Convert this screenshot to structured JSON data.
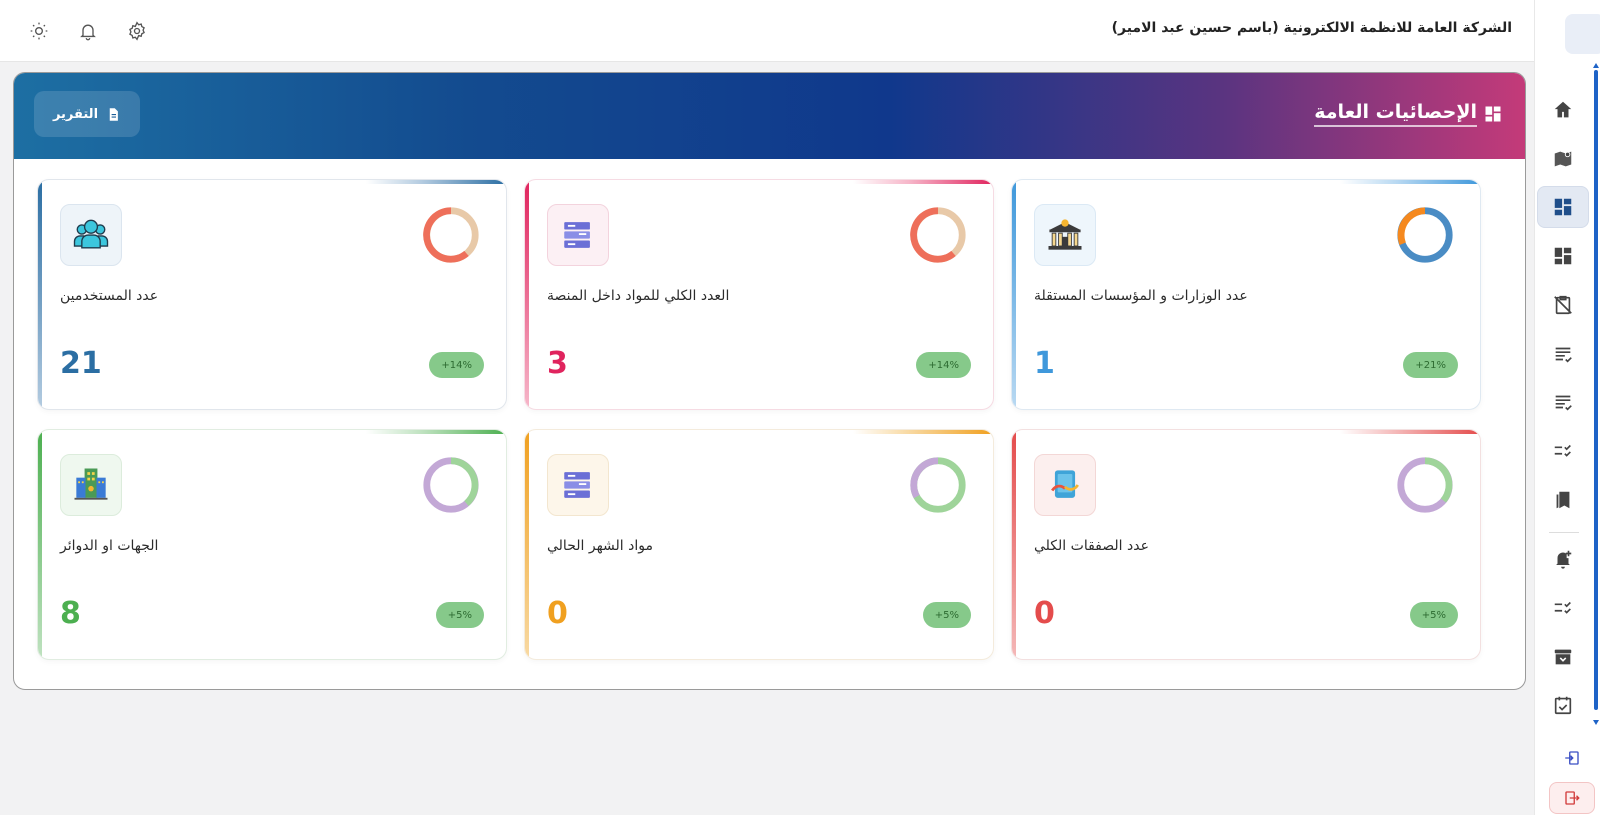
{
  "header": {
    "company": "الشركة العامة للانظمة الالكترونية (باسم حسين عبد الامير)"
  },
  "top_icons": [
    "sun-icon",
    "bell-icon",
    "gear-icon"
  ],
  "banner": {
    "title": "الإحصائيات العامة",
    "report_label": "التقرير"
  },
  "sidebar": {
    "items": [
      "home-icon",
      "map-icon",
      "dashboard-icon",
      "dashboard-alt-icon",
      "assignment-off-icon",
      "checklist-icon",
      "checklist-alt-icon",
      "list-check-icon",
      "bookmarks-icon",
      "notification-add-icon",
      "rule-icon",
      "archive-icon",
      "event-check-icon"
    ],
    "bottom": [
      "login-icon",
      "logout-icon"
    ]
  },
  "cards": [
    {
      "label": "عدد الوزارات و المؤسسات المستقلة",
      "value": "1",
      "badge": "+21%",
      "color": "#3f98db",
      "icon": "government-building-icon"
    },
    {
      "label": "العدد الكلي للمواد داخل المنصة",
      "value": "3",
      "badge": "+14%",
      "color": "#e0245e",
      "icon": "materials-icon"
    },
    {
      "label": "عدد المستخدمين",
      "value": "21",
      "badge": "+14%",
      "color": "#2b6ea3",
      "icon": "users-icon"
    },
    {
      "label": "عدد الصفقات الكلي",
      "value": "0",
      "badge": "+5%",
      "color": "#e44c4c",
      "icon": "transactions-icon"
    },
    {
      "label": "مواد الشهر الحالي",
      "value": "0",
      "badge": "+5%",
      "color": "#f0a020",
      "icon": "monthly-materials-icon"
    },
    {
      "label": "الجهات او الدوائر",
      "value": "8",
      "badge": "+5%",
      "color": "#4caf50",
      "icon": "departments-icon"
    }
  ]
}
